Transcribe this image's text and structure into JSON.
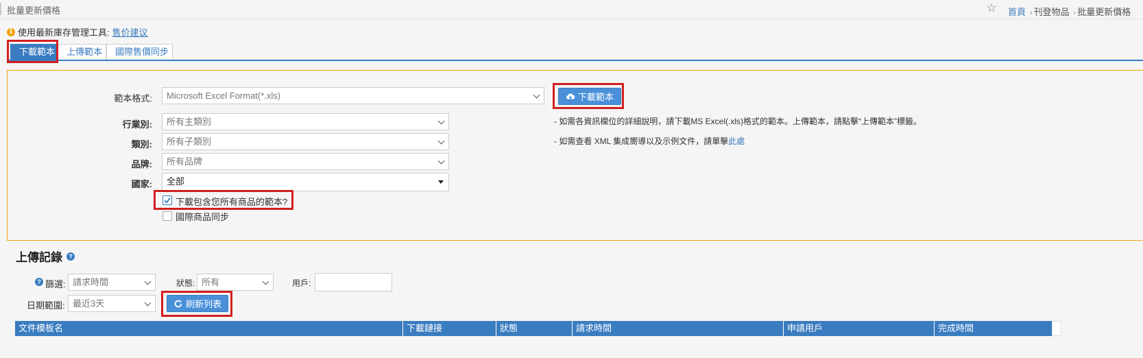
{
  "header": {
    "page_title": "批量更新價格",
    "breadcrumb": {
      "home": "首頁",
      "level2": "刊登物品",
      "current": "批量更新價格"
    }
  },
  "notice": {
    "text": "使用最新庫存管理工具:",
    "link": "售价建议"
  },
  "tabs": [
    {
      "label": "下載範本"
    },
    {
      "label": "上傳範本"
    },
    {
      "label": "國際售價同步"
    }
  ],
  "download_form": {
    "format_label": "範本格式:",
    "format_value": "Microsoft Excel Format(*.xls)",
    "download_button": "下載範本",
    "industry_label": "行業別:",
    "industry_value": "所有主類別",
    "category_label": "類別:",
    "category_value": "所有子類別",
    "brand_label": "品牌:",
    "brand_value": "所有品牌",
    "country_label": "國家:",
    "country_value": "全部",
    "include_all_label": "下載包含您所有商品的範本?",
    "include_all_checked": true,
    "intl_sync_label": "國際商品同步",
    "intl_sync_checked": false,
    "hint1": "- 如需各資訊欄位的詳細說明，請下載MS Excel(.xls)格式的範本。上傳範本，請點擊“上傳範本”標籤。",
    "hint2_prefix": "- 如需查看 XML 集成嚮導以及示例文件，請單擊",
    "hint2_link": "此處"
  },
  "upload_records": {
    "title": "上傳記錄",
    "filter_label": "篩選:",
    "filter_value": "請求時間",
    "status_label": "狀態:",
    "status_value": "所有",
    "user_label": "用戶:",
    "user_value": "",
    "date_range_label": "日期範圍:",
    "date_range_value": "最近3天",
    "refresh_button": "刷新列表",
    "columns": [
      "文件模板名",
      "下載鏈接",
      "狀態",
      "請求時間",
      "申請用戶",
      "完成時間"
    ]
  },
  "colors": {
    "primary": "#3a7cc0",
    "button": "#4a90d9",
    "highlight": "#d21f1f",
    "panel_border": "#f0a30a"
  }
}
